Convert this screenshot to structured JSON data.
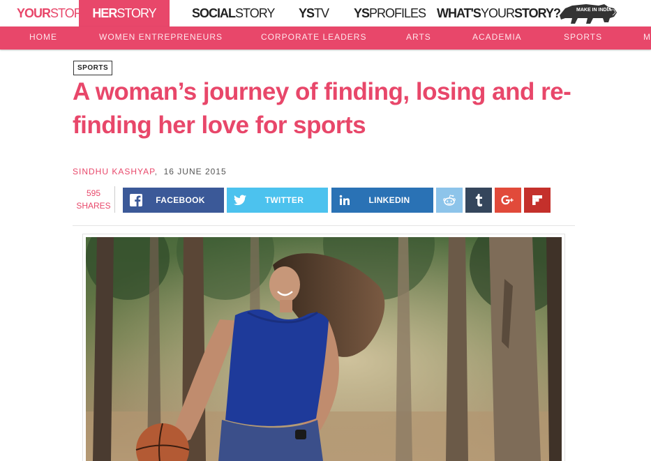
{
  "brands": {
    "yourstory": {
      "a": "YOUR",
      "b": "STORY"
    },
    "herstory": {
      "a": "HER",
      "b": "STORY"
    },
    "socialstory": {
      "a": "SOCIAL",
      "b": "STORY"
    },
    "ystv": {
      "a": "YS",
      "b": "TV"
    },
    "ysprofiles": {
      "a": "YS",
      "b": "PROFILES"
    },
    "whats": {
      "a": "WHAT'S",
      "b": "YOUR",
      "c": "STORY?"
    },
    "make_in_india": "MAKE IN INDIA"
  },
  "nav": [
    "HOME",
    "WOMEN ENTREPRENEURS",
    "CORPORATE LEADERS",
    "ARTS",
    "ACADEMIA",
    "SPORTS",
    "M"
  ],
  "article": {
    "tag": "SPORTS",
    "title": "A woman’s journey of finding, losing and re-finding her love for sports",
    "author": "SINDHU KASHYAP",
    "separator": ",",
    "date": "16 JUNE 2015"
  },
  "share": {
    "count": "595",
    "count_label": "SHARES",
    "facebook": "FACEBOOK",
    "twitter": "TWITTER",
    "linkedin": "LINKEDIN"
  },
  "icons": {
    "facebook": "facebook-icon",
    "twitter": "twitter-icon",
    "linkedin": "linkedin-icon",
    "reddit": "reddit-icon",
    "tumblr": "tumblr-icon",
    "googleplus": "google-plus-icon",
    "flipboard": "flipboard-icon"
  },
  "colors": {
    "accent": "#e8476a",
    "facebook": "#3b5998",
    "twitter": "#4cc2ee",
    "linkedin": "#2a72b5",
    "reddit": "#8dc4ea",
    "tumblr": "#35465c",
    "googleplus": "#e14a3a",
    "flipboard": "#c4302b"
  }
}
